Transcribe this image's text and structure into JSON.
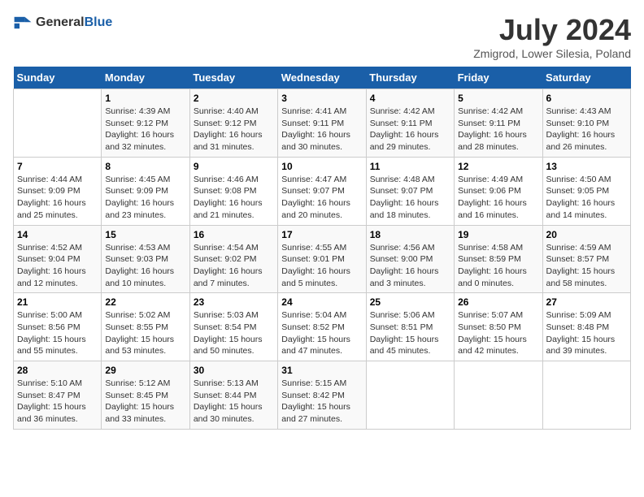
{
  "header": {
    "logo_general": "General",
    "logo_blue": "Blue",
    "title": "July 2024",
    "subtitle": "Zmigrod, Lower Silesia, Poland"
  },
  "columns": [
    "Sunday",
    "Monday",
    "Tuesday",
    "Wednesday",
    "Thursday",
    "Friday",
    "Saturday"
  ],
  "weeks": [
    [
      {
        "day": "",
        "info": ""
      },
      {
        "day": "1",
        "info": "Sunrise: 4:39 AM\nSunset: 9:12 PM\nDaylight: 16 hours and 32 minutes."
      },
      {
        "day": "2",
        "info": "Sunrise: 4:40 AM\nSunset: 9:12 PM\nDaylight: 16 hours and 31 minutes."
      },
      {
        "day": "3",
        "info": "Sunrise: 4:41 AM\nSunset: 9:11 PM\nDaylight: 16 hours and 30 minutes."
      },
      {
        "day": "4",
        "info": "Sunrise: 4:42 AM\nSunset: 9:11 PM\nDaylight: 16 hours and 29 minutes."
      },
      {
        "day": "5",
        "info": "Sunrise: 4:42 AM\nSunset: 9:11 PM\nDaylight: 16 hours and 28 minutes."
      },
      {
        "day": "6",
        "info": "Sunrise: 4:43 AM\nSunset: 9:10 PM\nDaylight: 16 hours and 26 minutes."
      }
    ],
    [
      {
        "day": "7",
        "info": "Sunrise: 4:44 AM\nSunset: 9:09 PM\nDaylight: 16 hours and 25 minutes."
      },
      {
        "day": "8",
        "info": "Sunrise: 4:45 AM\nSunset: 9:09 PM\nDaylight: 16 hours and 23 minutes."
      },
      {
        "day": "9",
        "info": "Sunrise: 4:46 AM\nSunset: 9:08 PM\nDaylight: 16 hours and 21 minutes."
      },
      {
        "day": "10",
        "info": "Sunrise: 4:47 AM\nSunset: 9:07 PM\nDaylight: 16 hours and 20 minutes."
      },
      {
        "day": "11",
        "info": "Sunrise: 4:48 AM\nSunset: 9:07 PM\nDaylight: 16 hours and 18 minutes."
      },
      {
        "day": "12",
        "info": "Sunrise: 4:49 AM\nSunset: 9:06 PM\nDaylight: 16 hours and 16 minutes."
      },
      {
        "day": "13",
        "info": "Sunrise: 4:50 AM\nSunset: 9:05 PM\nDaylight: 16 hours and 14 minutes."
      }
    ],
    [
      {
        "day": "14",
        "info": "Sunrise: 4:52 AM\nSunset: 9:04 PM\nDaylight: 16 hours and 12 minutes."
      },
      {
        "day": "15",
        "info": "Sunrise: 4:53 AM\nSunset: 9:03 PM\nDaylight: 16 hours and 10 minutes."
      },
      {
        "day": "16",
        "info": "Sunrise: 4:54 AM\nSunset: 9:02 PM\nDaylight: 16 hours and 7 minutes."
      },
      {
        "day": "17",
        "info": "Sunrise: 4:55 AM\nSunset: 9:01 PM\nDaylight: 16 hours and 5 minutes."
      },
      {
        "day": "18",
        "info": "Sunrise: 4:56 AM\nSunset: 9:00 PM\nDaylight: 16 hours and 3 minutes."
      },
      {
        "day": "19",
        "info": "Sunrise: 4:58 AM\nSunset: 8:59 PM\nDaylight: 16 hours and 0 minutes."
      },
      {
        "day": "20",
        "info": "Sunrise: 4:59 AM\nSunset: 8:57 PM\nDaylight: 15 hours and 58 minutes."
      }
    ],
    [
      {
        "day": "21",
        "info": "Sunrise: 5:00 AM\nSunset: 8:56 PM\nDaylight: 15 hours and 55 minutes."
      },
      {
        "day": "22",
        "info": "Sunrise: 5:02 AM\nSunset: 8:55 PM\nDaylight: 15 hours and 53 minutes."
      },
      {
        "day": "23",
        "info": "Sunrise: 5:03 AM\nSunset: 8:54 PM\nDaylight: 15 hours and 50 minutes."
      },
      {
        "day": "24",
        "info": "Sunrise: 5:04 AM\nSunset: 8:52 PM\nDaylight: 15 hours and 47 minutes."
      },
      {
        "day": "25",
        "info": "Sunrise: 5:06 AM\nSunset: 8:51 PM\nDaylight: 15 hours and 45 minutes."
      },
      {
        "day": "26",
        "info": "Sunrise: 5:07 AM\nSunset: 8:50 PM\nDaylight: 15 hours and 42 minutes."
      },
      {
        "day": "27",
        "info": "Sunrise: 5:09 AM\nSunset: 8:48 PM\nDaylight: 15 hours and 39 minutes."
      }
    ],
    [
      {
        "day": "28",
        "info": "Sunrise: 5:10 AM\nSunset: 8:47 PM\nDaylight: 15 hours and 36 minutes."
      },
      {
        "day": "29",
        "info": "Sunrise: 5:12 AM\nSunset: 8:45 PM\nDaylight: 15 hours and 33 minutes."
      },
      {
        "day": "30",
        "info": "Sunrise: 5:13 AM\nSunset: 8:44 PM\nDaylight: 15 hours and 30 minutes."
      },
      {
        "day": "31",
        "info": "Sunrise: 5:15 AM\nSunset: 8:42 PM\nDaylight: 15 hours and 27 minutes."
      },
      {
        "day": "",
        "info": ""
      },
      {
        "day": "",
        "info": ""
      },
      {
        "day": "",
        "info": ""
      }
    ]
  ]
}
